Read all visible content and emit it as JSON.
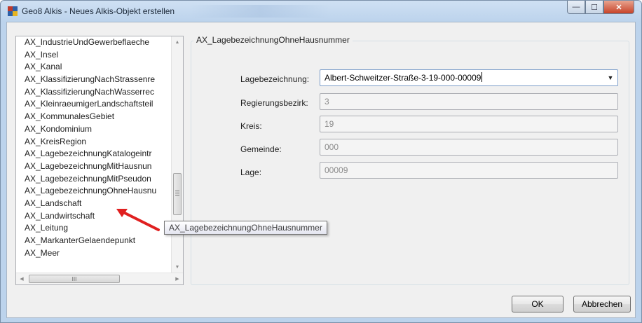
{
  "window": {
    "title": "Geo8 Alkis - Neues Alkis-Objekt erstellen",
    "caption_buttons": {
      "minimize": "—",
      "maximize": "☐",
      "close": "✕"
    }
  },
  "object_list": {
    "items": [
      "AX_IndustrieUndGewerbeflaeche",
      "AX_Insel",
      "AX_Kanal",
      "AX_KlassifizierungNachStrassenre",
      "AX_KlassifizierungNachWasserrec",
      "AX_KleinraeumigerLandschaftsteil",
      "AX_KommunalesGebiet",
      "AX_Kondominium",
      "AX_KreisRegion",
      "AX_LagebezeichnungKatalogeintr",
      "AX_LagebezeichnungMitHausnun",
      "AX_LagebezeichnungMitPseudon",
      "AX_LagebezeichnungOhneHausnu",
      "AX_Landschaft",
      "AX_Landwirtschaft",
      "AX_Leitung",
      "AX_MarkanterGelaendepunkt",
      "AX_Meer"
    ],
    "selected": "AX_LagebezeichnungOhneHausnu",
    "scroll_up_glyph": "▲",
    "scroll_down_glyph": "▼",
    "scroll_left_glyph": "◀",
    "scroll_right_glyph": "▶",
    "hthumb_grip": "III"
  },
  "tooltip": {
    "text": "AX_LagebezeichnungOhneHausnummer"
  },
  "form": {
    "group_title": "AX_LagebezeichnungOhneHausnummer",
    "fields": [
      {
        "label": "Lagebezeichnung:",
        "value": "Albert-Schweitzer-Straße-3-19-000-00009"
      },
      {
        "label": "Regierungsbezirk:",
        "value": "3"
      },
      {
        "label": "Kreis:",
        "value": "19"
      },
      {
        "label": "Gemeinde:",
        "value": "000"
      },
      {
        "label": "Lage:",
        "value": "00009"
      }
    ],
    "dropdown_glyph": "▼"
  },
  "buttons": {
    "ok": "OK",
    "cancel": "Abbrechen"
  },
  "colors": {
    "annotation_arrow": "#e02020"
  }
}
